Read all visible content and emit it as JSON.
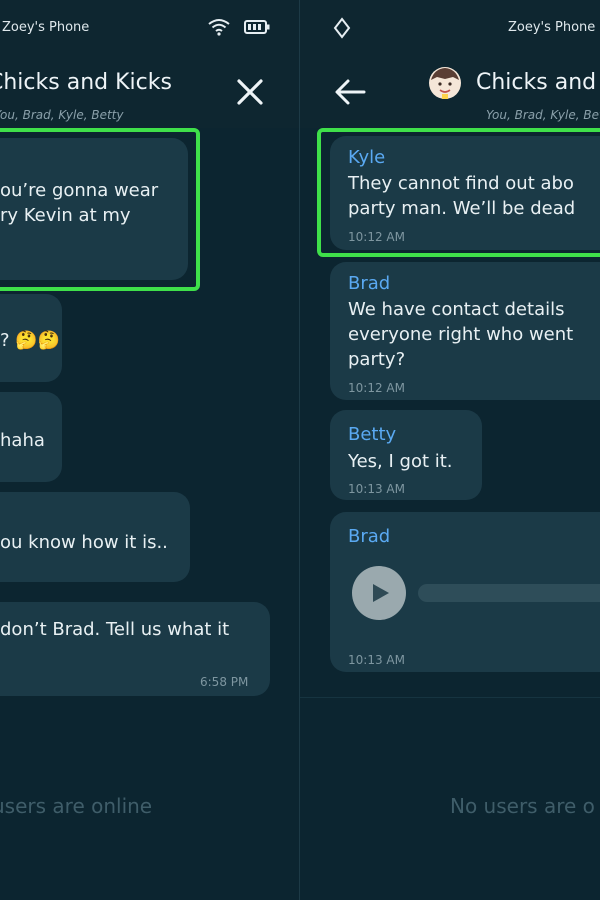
{
  "left": {
    "status_title": "Zoey's Phone",
    "chat_title": "Chicks and Kicks",
    "chat_members": "You, Brad, Kyle, Betty",
    "messages": [
      {
        "line1": "ou’re gonna wear",
        "line2": "ry Kevin at my"
      },
      {
        "line1": "? 🤔🤔"
      },
      {
        "line1": "haha"
      },
      {
        "line1": "ou know how it is.."
      },
      {
        "line1": "don’t Brad. Tell us what it",
        "time": "6:58 PM"
      }
    ],
    "online_text": "users are online"
  },
  "right": {
    "status_title": "Zoey's Phone",
    "chat_title": "Chicks and",
    "chat_members": "You, Brad, Kyle, Betty",
    "messages": [
      {
        "sender": "Kyle",
        "line1": "They cannot find out abo",
        "line2": "party man. We’ll be dead",
        "time": "10:12 AM"
      },
      {
        "sender": "Brad",
        "line1": "We have contact details",
        "line2": "everyone right who went",
        "line3": "party?",
        "time": "10:12 AM"
      },
      {
        "sender": "Betty",
        "line1": "Yes, I got it.",
        "time": "10:13 AM"
      },
      {
        "sender": "Brad",
        "time": "10:13 AM"
      }
    ],
    "online_text": "No users are o"
  },
  "colors": {
    "background": "#0c2530",
    "bubble": "#1b3a47",
    "accent_name": "#5aa9f2",
    "highlight": "#3fe04a"
  },
  "icons": [
    "wifi-icon",
    "battery-icon",
    "close-icon",
    "diamond-icon",
    "back-arrow-icon",
    "avatar",
    "play-icon"
  ]
}
